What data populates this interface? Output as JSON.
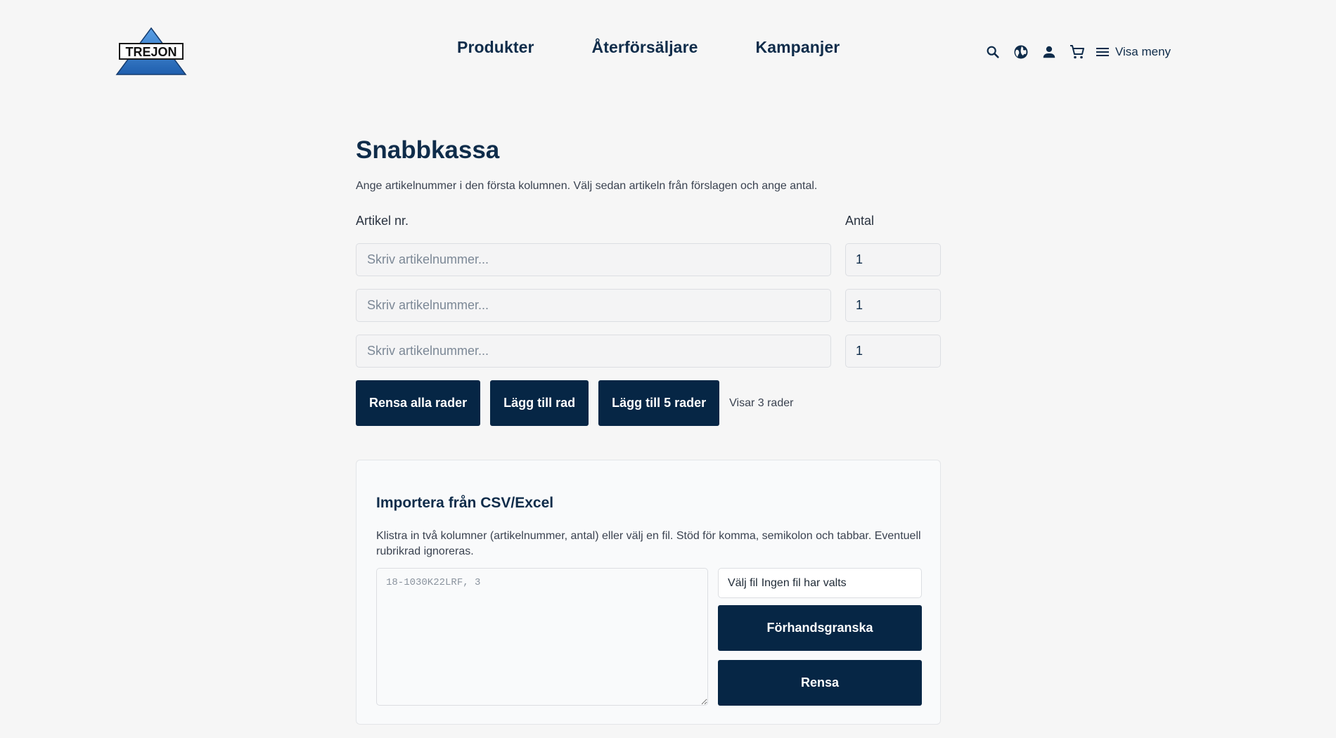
{
  "brand": {
    "name": "TREJON",
    "colors": {
      "navy": "#0f2c4a",
      "button": "#062645",
      "logo_blue": "#2f7dd0"
    }
  },
  "nav": {
    "items": [
      {
        "label": "Produkter"
      },
      {
        "label": "Återförsäljare"
      },
      {
        "label": "Kampanjer"
      }
    ]
  },
  "header_actions": {
    "icons": [
      "search-icon",
      "globe-icon",
      "user-icon",
      "cart-icon",
      "menu-icon"
    ],
    "menu_label": "Visa meny"
  },
  "page": {
    "title": "Snabbkassa",
    "intro": "Ange artikelnummer i den första kolumnen. Välj sedan artikeln från förslagen och ange antal.",
    "col_article": "Artikel nr.",
    "col_qty": "Antal"
  },
  "rows": [
    {
      "placeholder": "Skriv artikelnummer...",
      "qty": "1"
    },
    {
      "placeholder": "Skriv artikelnummer...",
      "qty": "1"
    },
    {
      "placeholder": "Skriv artikelnummer...",
      "qty": "1"
    }
  ],
  "buttons": {
    "clear_all": "Rensa alla rader",
    "add_row": "Lägg till rad",
    "add_five": "Lägg till 5 rader",
    "row_count": "Visar 3 rader"
  },
  "import": {
    "title": "Importera från CSV/Excel",
    "description": "Klistra in två kolumner (artikelnummer, antal) eller välj en fil. Stöd för komma, semikolon och tabbar. Eventuell rubrikrad ignoreras.",
    "textarea_placeholder": "18-1030K22LRF, 3",
    "file_button": "Välj fil",
    "file_status": "Ingen fil har valts",
    "preview": "Förhandsgranska",
    "clear": "Rensa"
  }
}
